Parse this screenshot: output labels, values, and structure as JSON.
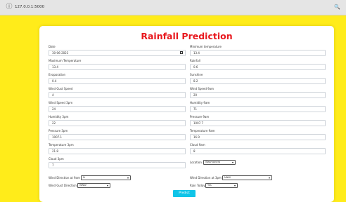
{
  "browser": {
    "url": "127.0.0.1:5000",
    "lock_icon": "info-icon",
    "zoom_icon": "zoom-icon"
  },
  "page": {
    "title": "Rainfall Prediction"
  },
  "fields": {
    "date": {
      "label": "Date",
      "value": "30-06-2023"
    },
    "min_temp": {
      "label": "Minimum temperature",
      "value": "13.4"
    },
    "max_temp": {
      "label": "Maximum Temperature",
      "value": "13.4"
    },
    "rainfall": {
      "label": "Rainfall",
      "value": "0.6"
    },
    "evaporation": {
      "label": "Evaporation",
      "value": "0.4"
    },
    "sunshine": {
      "label": "Sunshine",
      "value": "8.2"
    },
    "wind_gust_speed": {
      "label": "Wind Gust Speed",
      "value": "4"
    },
    "wind_speed_9am": {
      "label": "Wind Speed 9am",
      "value": "20"
    },
    "wind_speed_3pm": {
      "label": "Wind Speed 3pm",
      "value": "24"
    },
    "humidity_9am": {
      "label": "Humidity 9am",
      "value": "71"
    },
    "humidity_3pm": {
      "label": "Humidity 3pm",
      "value": "22"
    },
    "pressure_9am": {
      "label": "Pressure 9am",
      "value": "1007.7"
    },
    "pressure_3pm": {
      "label": "Pressure 3pm",
      "value": "1007.1"
    },
    "temperature_9am": {
      "label": "Temperature 9am",
      "value": "16.9"
    },
    "temperature_3pm": {
      "label": "Temperature 3pm",
      "value": "21.8"
    },
    "cloud_9am": {
      "label": "Cloud 9am",
      "value": "8"
    },
    "cloud_3pm": {
      "label": "Cloud 3pm",
      "value": "7"
    }
  },
  "selects": {
    "location": {
      "label": "Location",
      "value": "Wasmanero"
    },
    "wind_dir_9am": {
      "label": "Wind Direction at 9am",
      "value": "N"
    },
    "wind_dir_3pm": {
      "label": "Wind Direction at 3pm",
      "value": "NNW"
    },
    "wind_gust_dir": {
      "label": "Wind Gust Direction",
      "value": "WNW"
    },
    "rain_today": {
      "label": "Rain Today",
      "value": "Yes"
    }
  },
  "actions": {
    "predict_label": "Predict"
  },
  "colors": {
    "background": "#ffec1a",
    "title": "#e8181e",
    "button": "#10c4e8"
  }
}
